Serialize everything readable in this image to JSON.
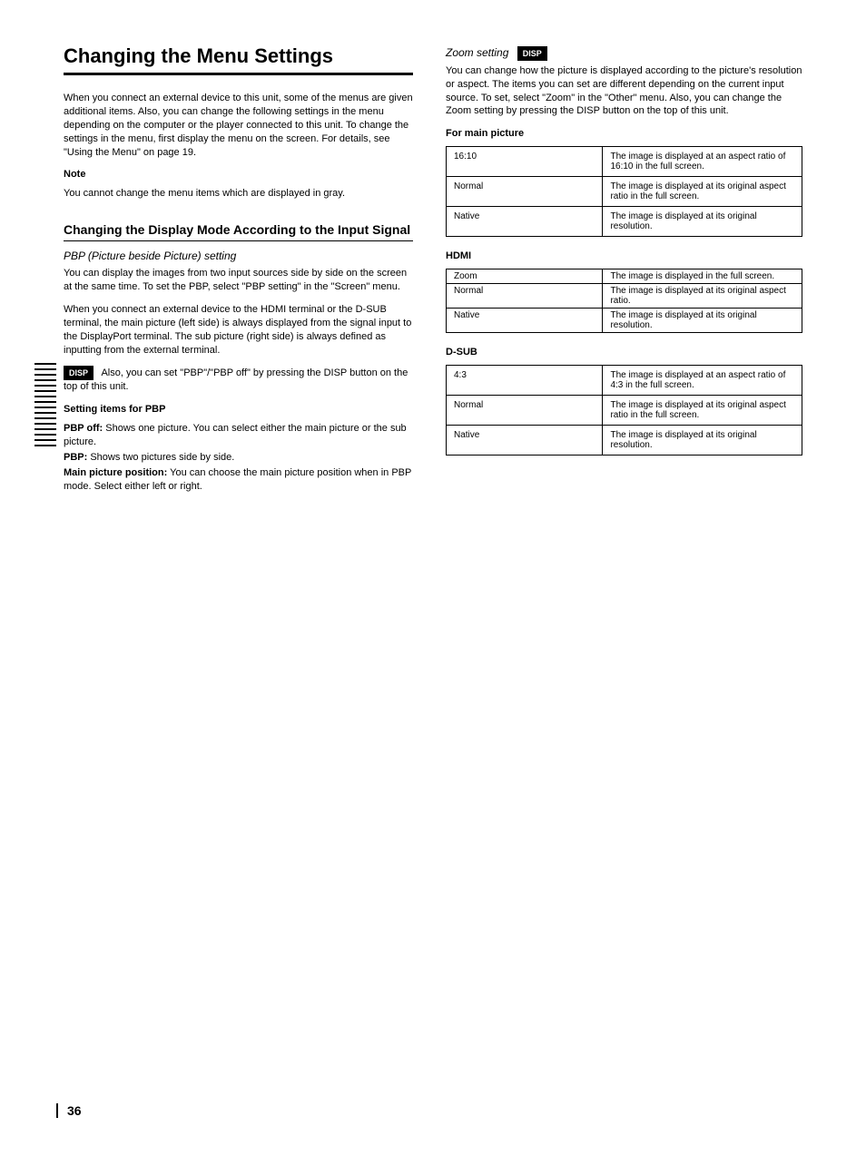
{
  "left": {
    "title": "Changing the Menu Settings",
    "intro": "When you connect an external device to this unit, some of the menus are given additional items. Also, you can change the following settings in the menu depending on the computer or the player connected to this unit. To change the settings in the menu, first display the menu on the screen. For details, see \"Using the Menu\" on page 19.",
    "note_title": "Note",
    "note_body": "You cannot change the menu items which are displayed in gray.",
    "sub_title": "Changing the Display Mode According to the Input Signal",
    "sub_sub": "PBP (Picture beside Picture) setting",
    "pbp1": "You can display the images from two input sources side by side on the screen at the same time. To set the PBP, select \"PBP setting\" in the \"Screen\" menu.",
    "pbp2": "When you connect an external device to the HDMI terminal or the D-SUB terminal, the main picture (left side) is always displayed from the signal input to the DisplayPort terminal. The sub picture (right side) is always defined as inputting from the external terminal.",
    "pbp_disp_label": "DISP",
    "pbp_disp_text": "Also, you can set \"PBP\"/\"PBP off\" by pressing the DISP button on the top of this unit.",
    "pbp_items_label": "Setting items for PBP",
    "pbp_off": {
      "label": "PBP off:",
      "text": "Shows one picture. You can select either the main picture or the sub picture."
    },
    "pbp_on": {
      "label": "PBP:",
      "text": "Shows two pictures side by side."
    },
    "pbp_main": {
      "label": "Main picture position:",
      "text": "You can choose the main picture position when in PBP mode. Select either left or right."
    }
  },
  "right": {
    "zoom_sub": "Zoom setting",
    "zoom_disp_label": "DISP",
    "zoom_para": "You can change how the picture is displayed according to the picture's resolution or aspect. The items you can set are different depending on the current input source. To set, select \"Zoom\" in the \"Other\" menu. Also, you can change the Zoom setting by pressing the DISP button on the top of this unit.",
    "tablesIntro": {
      "main": "For main picture",
      "hdmi": "HDMI",
      "dsub": "D-SUB"
    },
    "table_main": [
      {
        "c0": "16:10",
        "c1": "The image is displayed at an aspect ratio of 16:10 in the full screen."
      },
      {
        "c0": "Normal",
        "c1": "The image is displayed at its original aspect ratio in the full screen."
      },
      {
        "c0": "Native",
        "c1": "The image is displayed at its original resolution."
      }
    ],
    "table_hdmi": [
      {
        "c0": "Zoom",
        "c1": "The image is displayed in the full screen."
      },
      {
        "c0": "Normal",
        "c1": "The image is displayed at its original aspect ratio."
      },
      {
        "c0": "Native",
        "c1": "The image is displayed at its original resolution."
      }
    ],
    "table_dsub": [
      {
        "c0": "4:3",
        "c1": "The image is displayed at an aspect ratio of 4:3 in the full screen."
      },
      {
        "c0": "Normal",
        "c1": "The image is displayed at its original aspect ratio in the full screen."
      },
      {
        "c0": "Native",
        "c1": "The image is displayed at its original resolution."
      }
    ]
  },
  "pageNum": "36"
}
